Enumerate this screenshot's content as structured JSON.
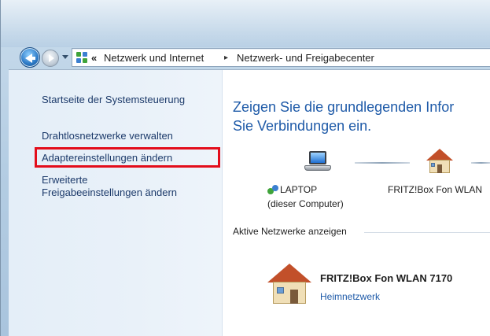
{
  "addressbar": {
    "overflow_chevron": "«",
    "crumbs": [
      "Netzwerk und Internet",
      "Netzwerk- und Freigabecenter"
    ],
    "separator": "▸"
  },
  "sidebar": {
    "items": [
      {
        "label": "Startseite der Systemsteuerung"
      },
      {
        "label": "Drahtlosnetzwerke verwalten"
      },
      {
        "label": "Adaptereinstellungen ändern"
      },
      {
        "label": "Erweiterte"
      },
      {
        "label": "Freigabeeinstellungen ändern"
      }
    ],
    "highlight_color": "#e30d1b"
  },
  "main": {
    "headline_line1": "Zeigen Sie die grundlegenden Infor",
    "headline_line2": "Sie Verbindungen ein.",
    "map": {
      "computer_label": "LAPTOP",
      "computer_sublabel": "(dieser Computer)",
      "router_label": "FRITZ!Box Fon WLAN"
    },
    "active_networks_title": "Aktive Netzwerke anzeigen",
    "network": {
      "name": "FRITZ!Box Fon WLAN 7170",
      "type": "Heimnetzwerk"
    }
  },
  "icons": {
    "back": "back-arrow-icon",
    "forward": "forward-arrow-icon",
    "control_panel": "control-panel-icon",
    "laptop": "laptop-icon",
    "router": "house-icon",
    "network": "network-icon"
  },
  "colors": {
    "link": "#1c3a6a",
    "headline": "#1e5aa8",
    "accent_link": "#1e5aa8"
  }
}
